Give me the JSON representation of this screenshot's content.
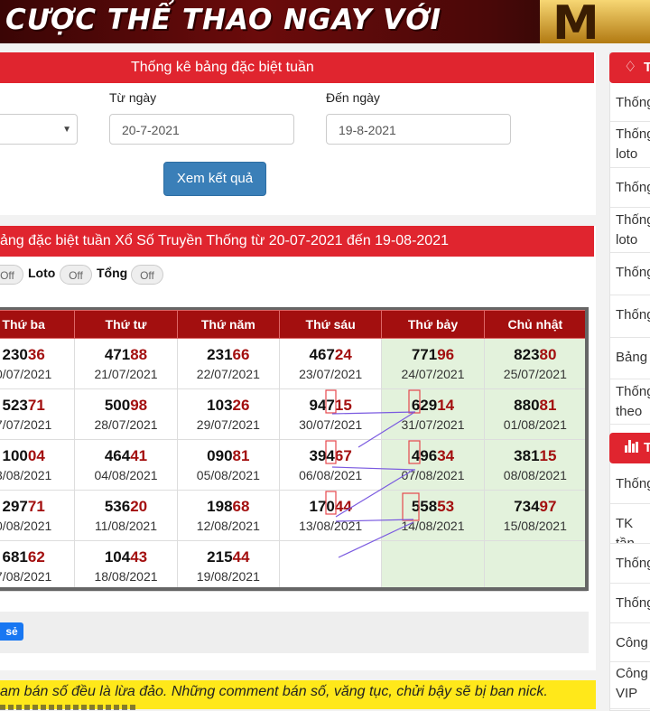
{
  "banner": {
    "text": "CƯỢC THỂ THAO NGAY VỚI",
    "logo": "M"
  },
  "search_panel": {
    "title": "Thống kê bảng đặc biệt tuần",
    "from_label": "Từ ngày",
    "to_label": "Đến ngày",
    "from_value": "20-7-2021",
    "to_value": "19-8-2021",
    "submit_label": "Xem kết quả"
  },
  "result_panel": {
    "title": "ảng đặc biệt tuần Xổ Số Truyền Thống từ 20-07-2021 đến 19-08-2021",
    "toggles": [
      {
        "label": "",
        "state": "Off"
      },
      {
        "label": "Loto",
        "state": "Off"
      },
      {
        "label": "Tổng",
        "state": "Off"
      }
    ]
  },
  "table": {
    "headers": [
      "Thứ ba",
      "Thứ tư",
      "Thứ năm",
      "Thứ sáu",
      "Thứ bảy",
      "Chủ nhật"
    ],
    "rows": [
      [
        {
          "head": "230",
          "tail": "36",
          "date": "0/07/2021"
        },
        {
          "head": "471",
          "tail": "88",
          "date": "21/07/2021"
        },
        {
          "head": "231",
          "tail": "66",
          "date": "22/07/2021"
        },
        {
          "head": "467",
          "tail": "24",
          "date": "23/07/2021"
        },
        {
          "head": "771",
          "tail": "96",
          "date": "24/07/2021"
        },
        {
          "head": "823",
          "tail": "80",
          "date": "25/07/2021"
        }
      ],
      [
        {
          "head": "523",
          "tail": "71",
          "date": "7/07/2021"
        },
        {
          "head": "500",
          "tail": "98",
          "date": "28/07/2021"
        },
        {
          "head": "103",
          "tail": "26",
          "date": "29/07/2021"
        },
        {
          "head": "947",
          "tail": "15",
          "date": "30/07/2021"
        },
        {
          "head": "629",
          "tail": "14",
          "date": "31/07/2021"
        },
        {
          "head": "880",
          "tail": "81",
          "date": "01/08/2021"
        }
      ],
      [
        {
          "head": "100",
          "tail": "04",
          "date": "3/08/2021"
        },
        {
          "head": "464",
          "tail": "41",
          "date": "04/08/2021"
        },
        {
          "head": "090",
          "tail": "81",
          "date": "05/08/2021"
        },
        {
          "head": "394",
          "tail": "67",
          "date": "06/08/2021"
        },
        {
          "head": "496",
          "tail": "34",
          "date": "07/08/2021"
        },
        {
          "head": "381",
          "tail": "15",
          "date": "08/08/2021"
        }
      ],
      [
        {
          "head": "297",
          "tail": "71",
          "date": "0/08/2021"
        },
        {
          "head": "536",
          "tail": "20",
          "date": "11/08/2021"
        },
        {
          "head": "198",
          "tail": "68",
          "date": "12/08/2021"
        },
        {
          "head": "170",
          "tail": "44",
          "date": "13/08/2021"
        },
        {
          "head": "558",
          "tail": "53",
          "date": "14/08/2021"
        },
        {
          "head": "734",
          "tail": "97",
          "date": "15/08/2021"
        }
      ],
      [
        {
          "head": "681",
          "tail": "62",
          "date": "7/08/2021"
        },
        {
          "head": "104",
          "tail": "43",
          "date": "18/08/2021"
        },
        {
          "head": "215",
          "tail": "44",
          "date": "19/08/2021"
        },
        null,
        null,
        null
      ]
    ]
  },
  "share_button": "sẻ",
  "notice": "am bán số đều là lừa đảo. Những comment bán số, văng tục, chửi bậy sẽ bị ban nick.",
  "sidebar": {
    "head1_icon": "diamond-icon",
    "head1_text": "T",
    "group1": [
      "Thống",
      "Thống loto",
      "Thống",
      "Thống loto",
      "Thống",
      "Thống",
      "Bảng",
      "Thống theo E"
    ],
    "head2_icon": "bar-chart-icon",
    "head2_text": "T",
    "group2": [
      "Thống",
      "TK tần",
      "Thống",
      "Thống",
      "Công",
      "Công VIP"
    ]
  },
  "colors": {
    "accent_red": "#e0252f",
    "table_header": "#a30f0f",
    "weekend_bg": "#e3f2dc",
    "button_blue": "#3a7fb8"
  }
}
